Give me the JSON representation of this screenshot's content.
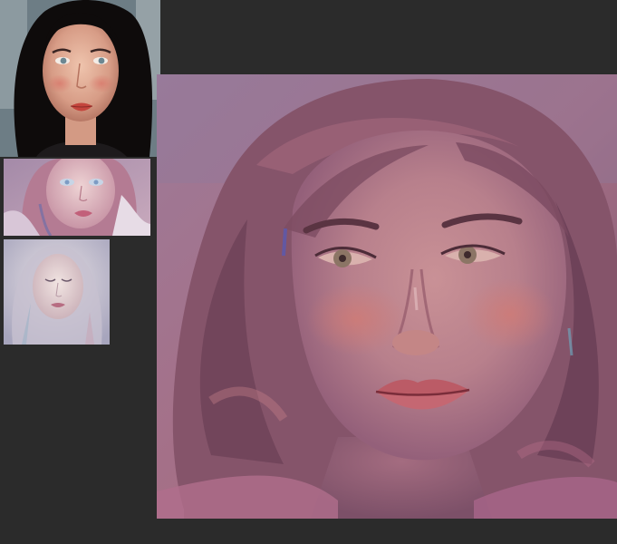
{
  "workspace": {
    "background": "#2b2b2b",
    "references": [
      {
        "name": "reference-photo-portrait",
        "palette": [
          "#0f0c0c",
          "#e0b29c",
          "#c45a4f",
          "#6f8a98"
        ]
      },
      {
        "name": "reference-painting-pink-portrait",
        "palette": [
          "#b79ab2",
          "#e1c6cc",
          "#c07c90",
          "#7b6d9a"
        ]
      },
      {
        "name": "reference-painting-pale-portrait",
        "palette": [
          "#b9b4c6",
          "#e6dce0",
          "#7c6c8c",
          "#c49aa4"
        ]
      }
    ],
    "canvas": {
      "name": "main-painting-canvas",
      "palette": [
        "#8d5d73",
        "#c9889a",
        "#6d4060",
        "#b87880",
        "#9a6f82"
      ]
    }
  }
}
